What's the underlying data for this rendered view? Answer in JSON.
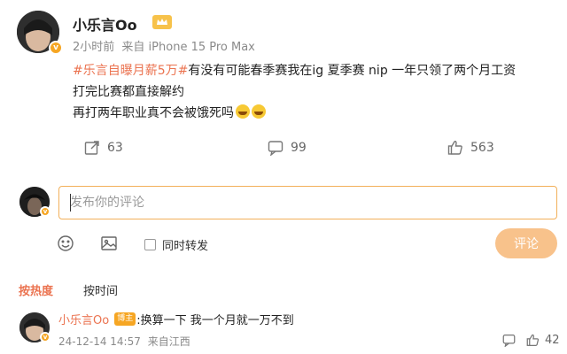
{
  "post": {
    "username": "小乐言Oo",
    "time": "2小时前",
    "source": "来自 iPhone 15 Pro Max",
    "hashtag": "#乐言自曝月薪5万#",
    "line1_text": "有没有可能春季赛我在ig 夏季赛 nip 一年只领了两个月工资",
    "line2": "打完比赛都直接解约",
    "line3": "再打两年职业真不会被饿死吗"
  },
  "actions": {
    "repost_count": "63",
    "comment_count": "99",
    "like_count": "563"
  },
  "composer": {
    "placeholder": "发布你的评论",
    "repost_label": "同时转发",
    "submit_label": "评论"
  },
  "sort": {
    "hot": "按热度",
    "time": "按时间"
  },
  "comment": {
    "username": "小乐言Oo",
    "badge": "博主",
    "text": ":换算一下 我一个月就一万不到",
    "date": "24-12-14 14:57",
    "location": "来自江西",
    "like_count": "42"
  },
  "colors": {
    "accent": "#eb7350",
    "verified": "#f6a623",
    "input_border": "#f2b05a",
    "submit_bg": "#f8c28b"
  },
  "icons": [
    "crown-icon",
    "repost-icon",
    "comment-icon",
    "like-icon",
    "emoji-icon",
    "image-icon",
    "reply-icon",
    "verified-icon"
  ]
}
